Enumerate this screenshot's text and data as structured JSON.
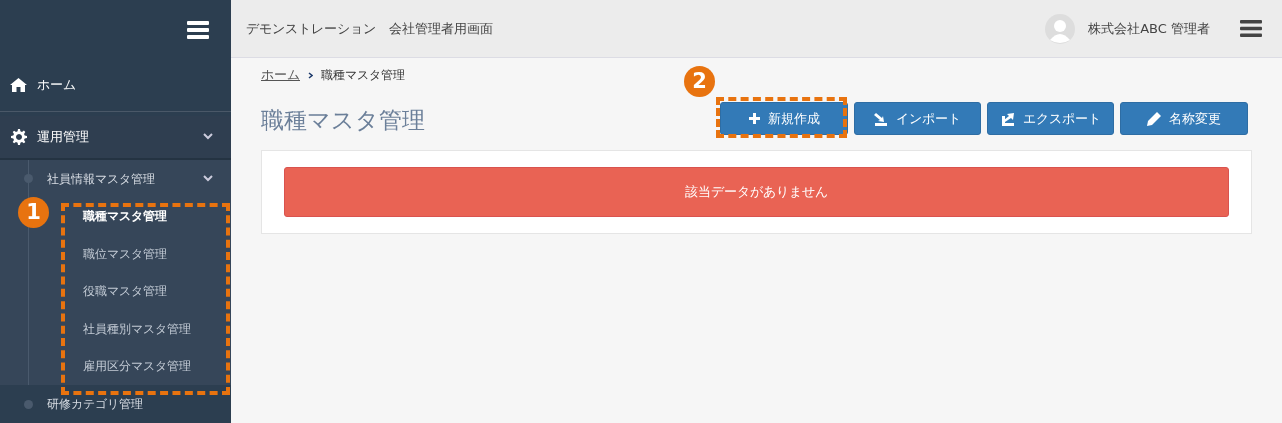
{
  "header": {
    "title": "デモンストレーション　会社管理者用画面",
    "user": "株式会社ABC 管理者"
  },
  "sidebar": {
    "items": [
      {
        "label": "ホーム"
      },
      {
        "label": "運用管理",
        "expanded": true,
        "children": [
          {
            "label": "社員情報マスタ管理",
            "expanded": true,
            "children": [
              {
                "label": "職種マスタ管理",
                "selected": true
              },
              {
                "label": "職位マスタ管理",
                "selected": false
              },
              {
                "label": "役職マスタ管理",
                "selected": false
              },
              {
                "label": "社員種別マスタ管理",
                "selected": false
              },
              {
                "label": "雇用区分マスタ管理",
                "selected": false
              }
            ]
          },
          {
            "label": "研修カテゴリ管理"
          }
        ]
      }
    ]
  },
  "breadcrumb": [
    {
      "label": "ホーム",
      "kind": "link"
    },
    {
      "label": "職種マスタ管理",
      "kind": "current"
    }
  ],
  "page_title": "職種マスタ管理",
  "buttons": [
    {
      "label": "新規作成"
    },
    {
      "label": "インポート"
    },
    {
      "label": "エクスポート"
    },
    {
      "label": "名称変更"
    }
  ],
  "alert": "該当データがありません",
  "callouts": [
    {
      "label": "1"
    },
    {
      "label": "2"
    }
  ]
}
